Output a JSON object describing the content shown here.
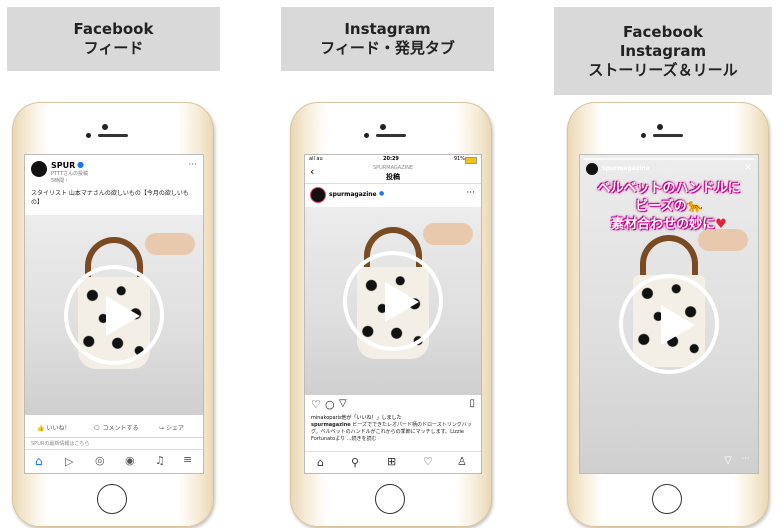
{
  "columns": [
    {
      "label_lines": [
        "Facebook",
        "フィード"
      ]
    },
    {
      "label_lines": [
        "Instagram",
        "フィード・発見タブ"
      ]
    },
    {
      "label_lines": [
        "Facebook",
        "Instagram",
        "ストーリーズ＆リール"
      ]
    }
  ],
  "facebook_feed": {
    "page_name": "SPUR",
    "page_sub": "PTTTさんの投稿",
    "post_time": "5時間・",
    "caption": "スタイリスト 山本マナさんの欲しいもの【今月の欲しいも の】",
    "like": "いいね！",
    "comment": "コメントする",
    "share": "シェア",
    "next_post": "SPURの最新情報はこちら",
    "nav_icons": [
      "home-icon",
      "video-icon",
      "profile-icon",
      "groups-icon",
      "bell-icon",
      "menu-icon"
    ]
  },
  "instagram_feed": {
    "status_left": "all au",
    "time": "20:29",
    "battery": "91%",
    "header_sub": "SPURMAGAZINE",
    "header_title": "投稿",
    "account": "spurmagazine",
    "liked_by": "minakoparis他が「いいね！」しました",
    "caption_user": "spurmagazine",
    "caption": "ビーズでできたレオパード柄のドローストリングバッグ。ベルベットのハンドルがこれからの季節にマッチします。Lizzie Fortunatoより ...続きを読む",
    "nav_icons": [
      "home-icon",
      "search-icon",
      "add-icon",
      "heart-icon",
      "profile-icon"
    ]
  },
  "story": {
    "account": "spurmagazine",
    "time": "23時間",
    "line1": "ベルベットのハンドルに",
    "line2": "ビーズの",
    "line3": "素材合わせの妙に",
    "close": "×"
  }
}
